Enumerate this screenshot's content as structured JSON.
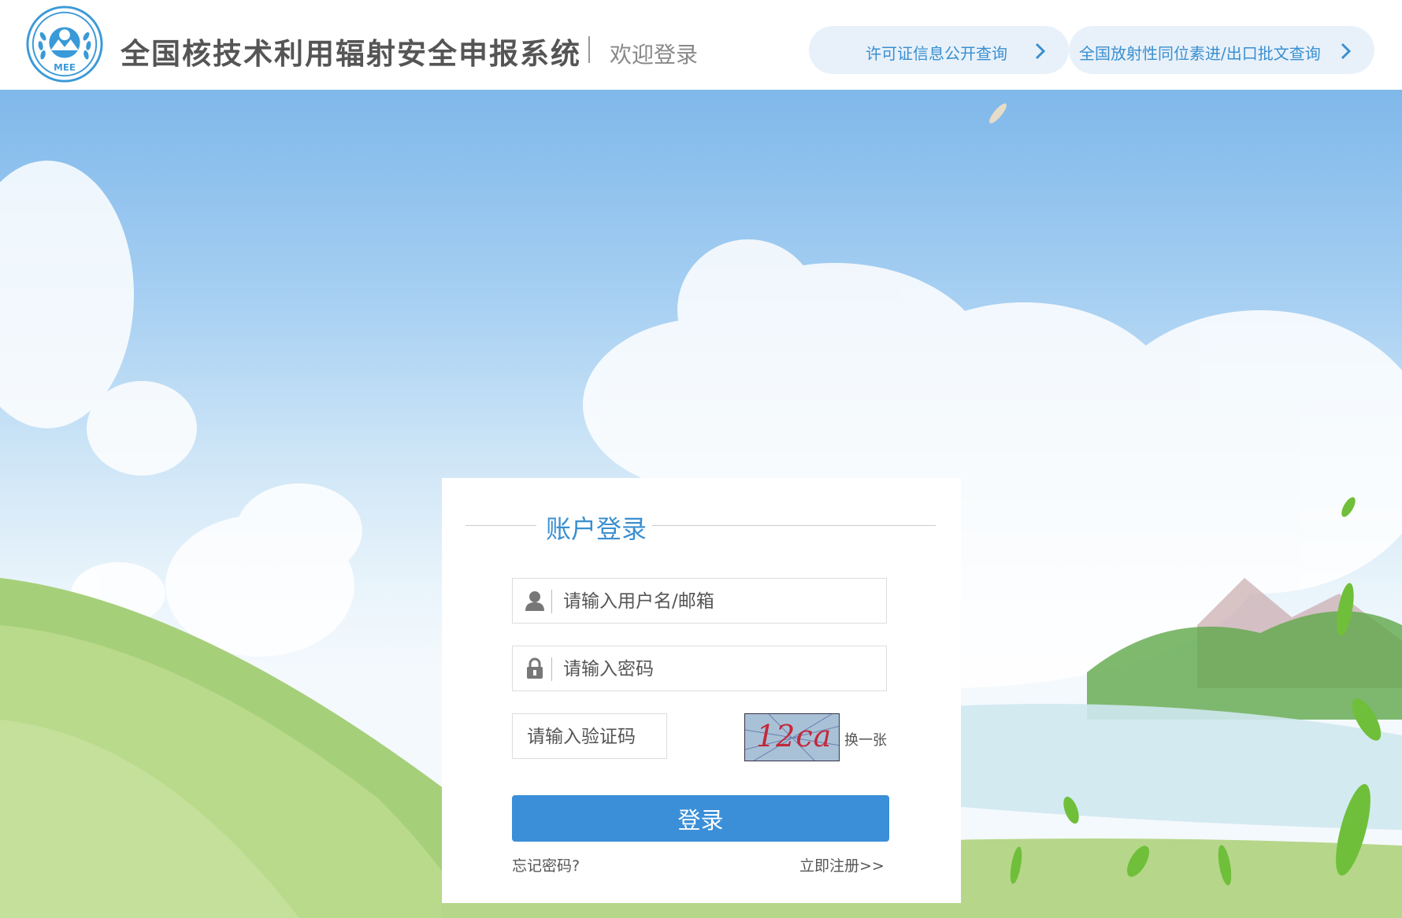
{
  "header": {
    "logo_text": "MEE",
    "site_title": "全国核技术利用辐射安全申报系统",
    "welcome": "欢迎登录",
    "links": [
      {
        "label": "许可证信息公开查询"
      },
      {
        "label": "全国放射性同位素进/出口批文查询"
      }
    ]
  },
  "login": {
    "title": "账户登录",
    "username_placeholder": "请输入用户名/邮箱",
    "password_placeholder": "请输入密码",
    "captcha_placeholder": "请输入验证码",
    "captcha_text": "12ca",
    "refresh_label": "换一张",
    "submit_label": "登录",
    "forgot_label": "忘记密码?",
    "register_label": "立即注册>>"
  },
  "colors": {
    "accent": "#3a8fd8",
    "title_blue": "#3a8fd0",
    "pill_bg": "#e8f1fa"
  }
}
